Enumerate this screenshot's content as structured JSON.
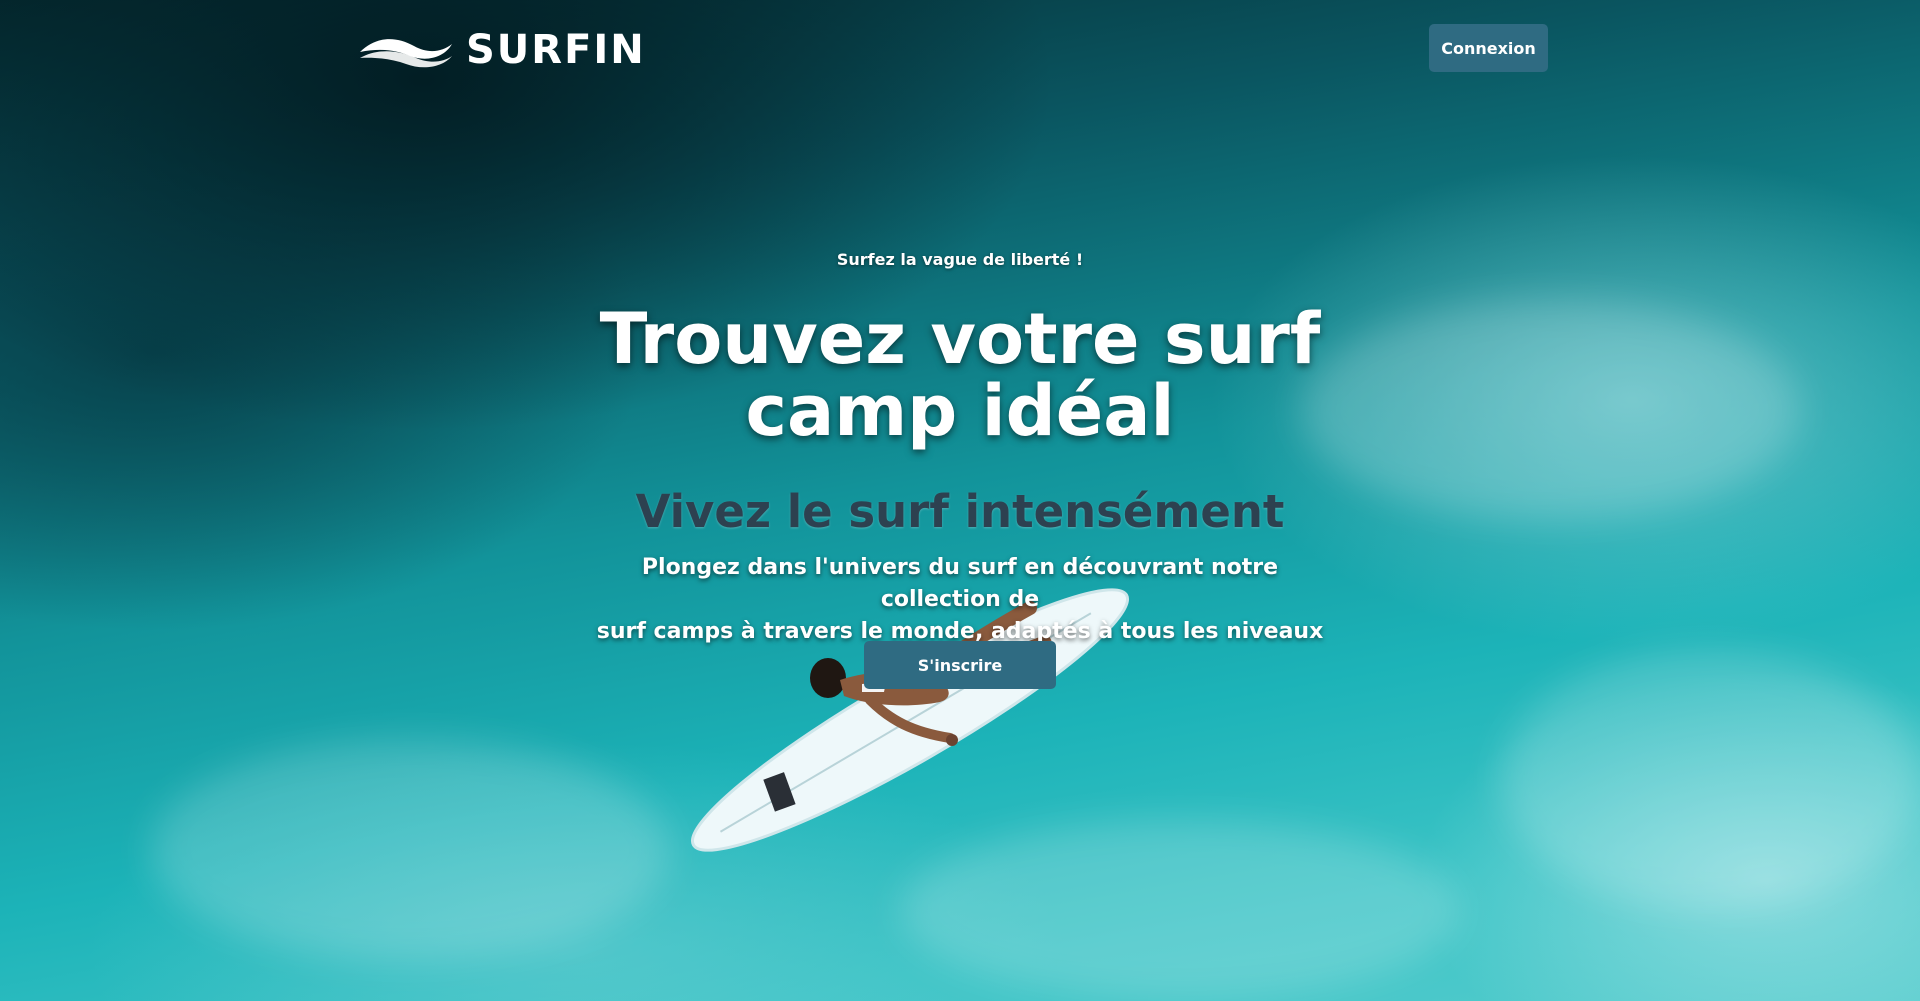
{
  "header": {
    "brand_name": "SURFIN",
    "login_label": "Connexion"
  },
  "hero": {
    "tagline": "Surfez la vague de liberté !",
    "headline_line1": "Trouvez votre surf",
    "headline_line2": "camp idéal",
    "subheadline": "Vivez le surf intensément",
    "description_line1": "Plongez dans l'univers du surf en découvrant notre collection de",
    "description_line2": "surf camps à travers le monde, adaptés à tous les niveaux",
    "signup_label": "S'inscrire"
  },
  "colors": {
    "button_bg": "#2f6b82",
    "subheadline_color": "#2d4150",
    "ocean_dark": "#042a30",
    "ocean_light": "#3cc4c6"
  },
  "icons": {
    "logo": "wave-logo-icon"
  }
}
